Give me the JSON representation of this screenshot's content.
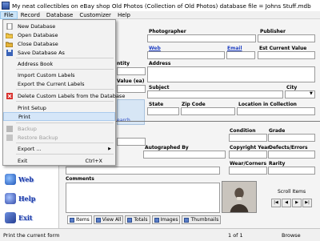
{
  "title_bar": {
    "text": "My neat collectibles on eBay shop Old Photos (Collection of Old Photos) database file = Johns Stuff.mdb"
  },
  "menu_bar": [
    "File",
    "Record",
    "Database",
    "Customizer",
    "Help"
  ],
  "file_menu": {
    "items": [
      {
        "label": "New Database",
        "icon": "new-database-icon",
        "enabled": true
      },
      {
        "label": "Open Database",
        "icon": "open-database-icon",
        "enabled": true
      },
      {
        "label": "Close Database",
        "icon": "close-database-icon",
        "enabled": true
      },
      {
        "label": "Save Database As",
        "icon": "save-database-icon",
        "enabled": true
      },
      {
        "label": "Address Book",
        "enabled": true
      },
      {
        "label": "Import Custom Labels",
        "enabled": true
      },
      {
        "label": "Export the Current Labels",
        "enabled": true
      },
      {
        "label": "Delete Custom Labels from the Database",
        "icon": "delete-icon",
        "enabled": true
      },
      {
        "label": "Print Setup",
        "enabled": true
      },
      {
        "label": "Print",
        "enabled": true,
        "highlighted": true
      },
      {
        "label": "Backup",
        "icon": "backup-icon",
        "enabled": false
      },
      {
        "label": "Restore Backup",
        "icon": "restore-icon",
        "enabled": false
      },
      {
        "label": "Export ...",
        "enabled": true,
        "submenu": true
      },
      {
        "label": "Exit",
        "shortcut": "Ctrl+X",
        "enabled": true
      }
    ]
  },
  "sidebar": {
    "buttons": [
      {
        "label": "Web",
        "icon": "web-icon"
      },
      {
        "label": "Help",
        "icon": "help-icon"
      },
      {
        "label": "Exit",
        "icon": "exit-icon"
      }
    ]
  },
  "form": {
    "labels": {
      "photographer": "Photographer",
      "publisher": "Publisher",
      "web": "Web",
      "email": "Email",
      "est_current_value": "Est Current Value",
      "quantity_partial": "ntity",
      "address": "Address",
      "value_ea_partial": "Value (ea)",
      "subject": "Subject",
      "city": "City",
      "state": "State",
      "zip_code": "Zip Code",
      "location_in_collection": "Location in Collection",
      "condition": "Condition",
      "grade": "Grade",
      "autographed_by": "Autographed By",
      "copyright_year": "Copyright Year",
      "defects_errors": "Defects/Errors",
      "wear_corners": "Wear/Corners",
      "rarity": "Rarity",
      "comments": "Comments",
      "scroll_items": "Scroll Items"
    },
    "search_link_partial": "earch"
  },
  "tabs": [
    "Items",
    "View All",
    "Totals",
    "Images",
    "Thumbnails"
  ],
  "status_bar": {
    "message": "Print the current form",
    "record_position": "1 of 1",
    "mode": "Browse"
  },
  "colors": {
    "menu_highlight": "#d5e6f8",
    "link_blue": "#1f3fc2",
    "panel_blue": "#d7e6f5"
  }
}
